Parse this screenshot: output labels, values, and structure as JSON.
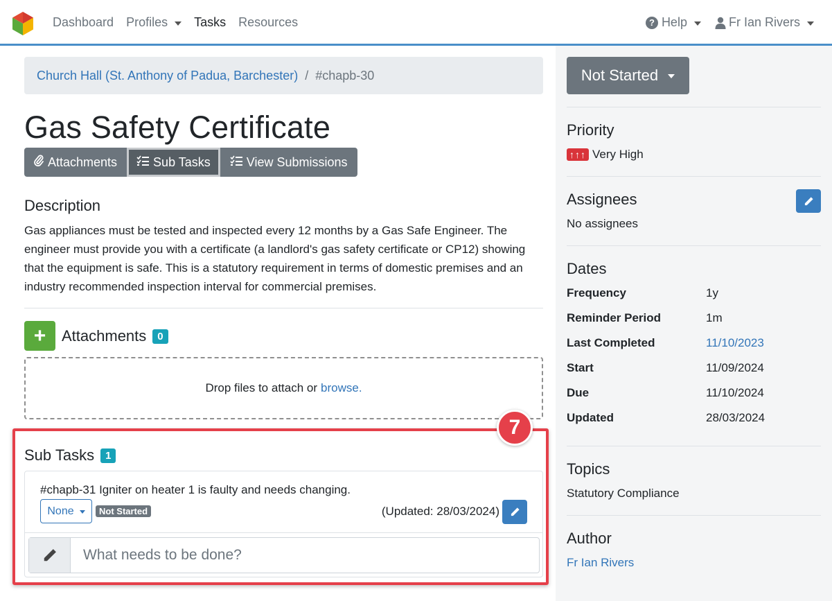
{
  "nav": {
    "items": [
      {
        "label": "Dashboard",
        "dropdown": false,
        "active": false
      },
      {
        "label": "Profiles",
        "dropdown": true,
        "active": false
      },
      {
        "label": "Tasks",
        "dropdown": false,
        "active": true
      },
      {
        "label": "Resources",
        "dropdown": false,
        "active": false
      }
    ],
    "help_label": "Help",
    "user_label": "Fr Ian Rivers"
  },
  "breadcrumb": {
    "parent": "Church Hall (St. Anthony of Padua, Barchester)",
    "separator": "/",
    "current": "#chapb-30"
  },
  "page_title": "Gas Safety Certificate",
  "tabs": [
    {
      "label": "Attachments",
      "icon": "paperclip-icon",
      "glyph": "🖇",
      "active": false
    },
    {
      "label": "Sub Tasks",
      "icon": "checklist-icon",
      "glyph": "☷",
      "active": true
    },
    {
      "label": "View Submissions",
      "icon": "checklist-icon",
      "glyph": "☷",
      "active": false
    }
  ],
  "description": {
    "title": "Description",
    "text": "Gas appliances must be tested and inspected every 12 months by a Gas Safe Engineer. The engineer must provide you with a certificate (a landlord's gas safety certificate or CP12) showing that the equipment is safe. This is a statutory requirement in terms of domestic premises and an industry recommended inspection interval for commercial premises."
  },
  "attachments": {
    "title": "Attachments",
    "count": "0",
    "add_label": "+",
    "drop_text": "Drop files to attach or",
    "browse_label": "browse."
  },
  "subtasks": {
    "title": "Sub Tasks",
    "count": "1",
    "items": [
      {
        "text": "#chapb-31 Igniter on heater 1 is faulty and needs changing.",
        "assignee": "None",
        "status": "Not Started",
        "updated": "(Updated: 28/03/2024)"
      }
    ],
    "new_placeholder": "What needs to be done?"
  },
  "annotation_marker": "7",
  "sidebar": {
    "status": "Not Started",
    "priority_title": "Priority",
    "priority_arrows": "↑↑↑",
    "priority_value": "Very High",
    "assignees_title": "Assignees",
    "assignees_value": "No assignees",
    "dates_title": "Dates",
    "dates": [
      {
        "label": "Frequency",
        "value": "1y",
        "link": false
      },
      {
        "label": "Reminder Period",
        "value": "1m",
        "link": false
      },
      {
        "label": "Last Completed",
        "value": "11/10/2023",
        "link": true
      },
      {
        "label": "Start",
        "value": "11/09/2024",
        "link": false
      },
      {
        "label": "Due",
        "value": "11/10/2024",
        "link": false
      },
      {
        "label": "Updated",
        "value": "28/03/2024",
        "link": false
      }
    ],
    "topics_title": "Topics",
    "topics_value": "Statutory Compliance",
    "author_title": "Author",
    "author_value": "Fr Ian Rivers"
  },
  "colors": {
    "accent": "#3275b8",
    "secondary": "#6c757d",
    "success": "#5aaa3c",
    "danger": "#d9343a",
    "info": "#17a2b8",
    "highlight": "#e5404a"
  }
}
